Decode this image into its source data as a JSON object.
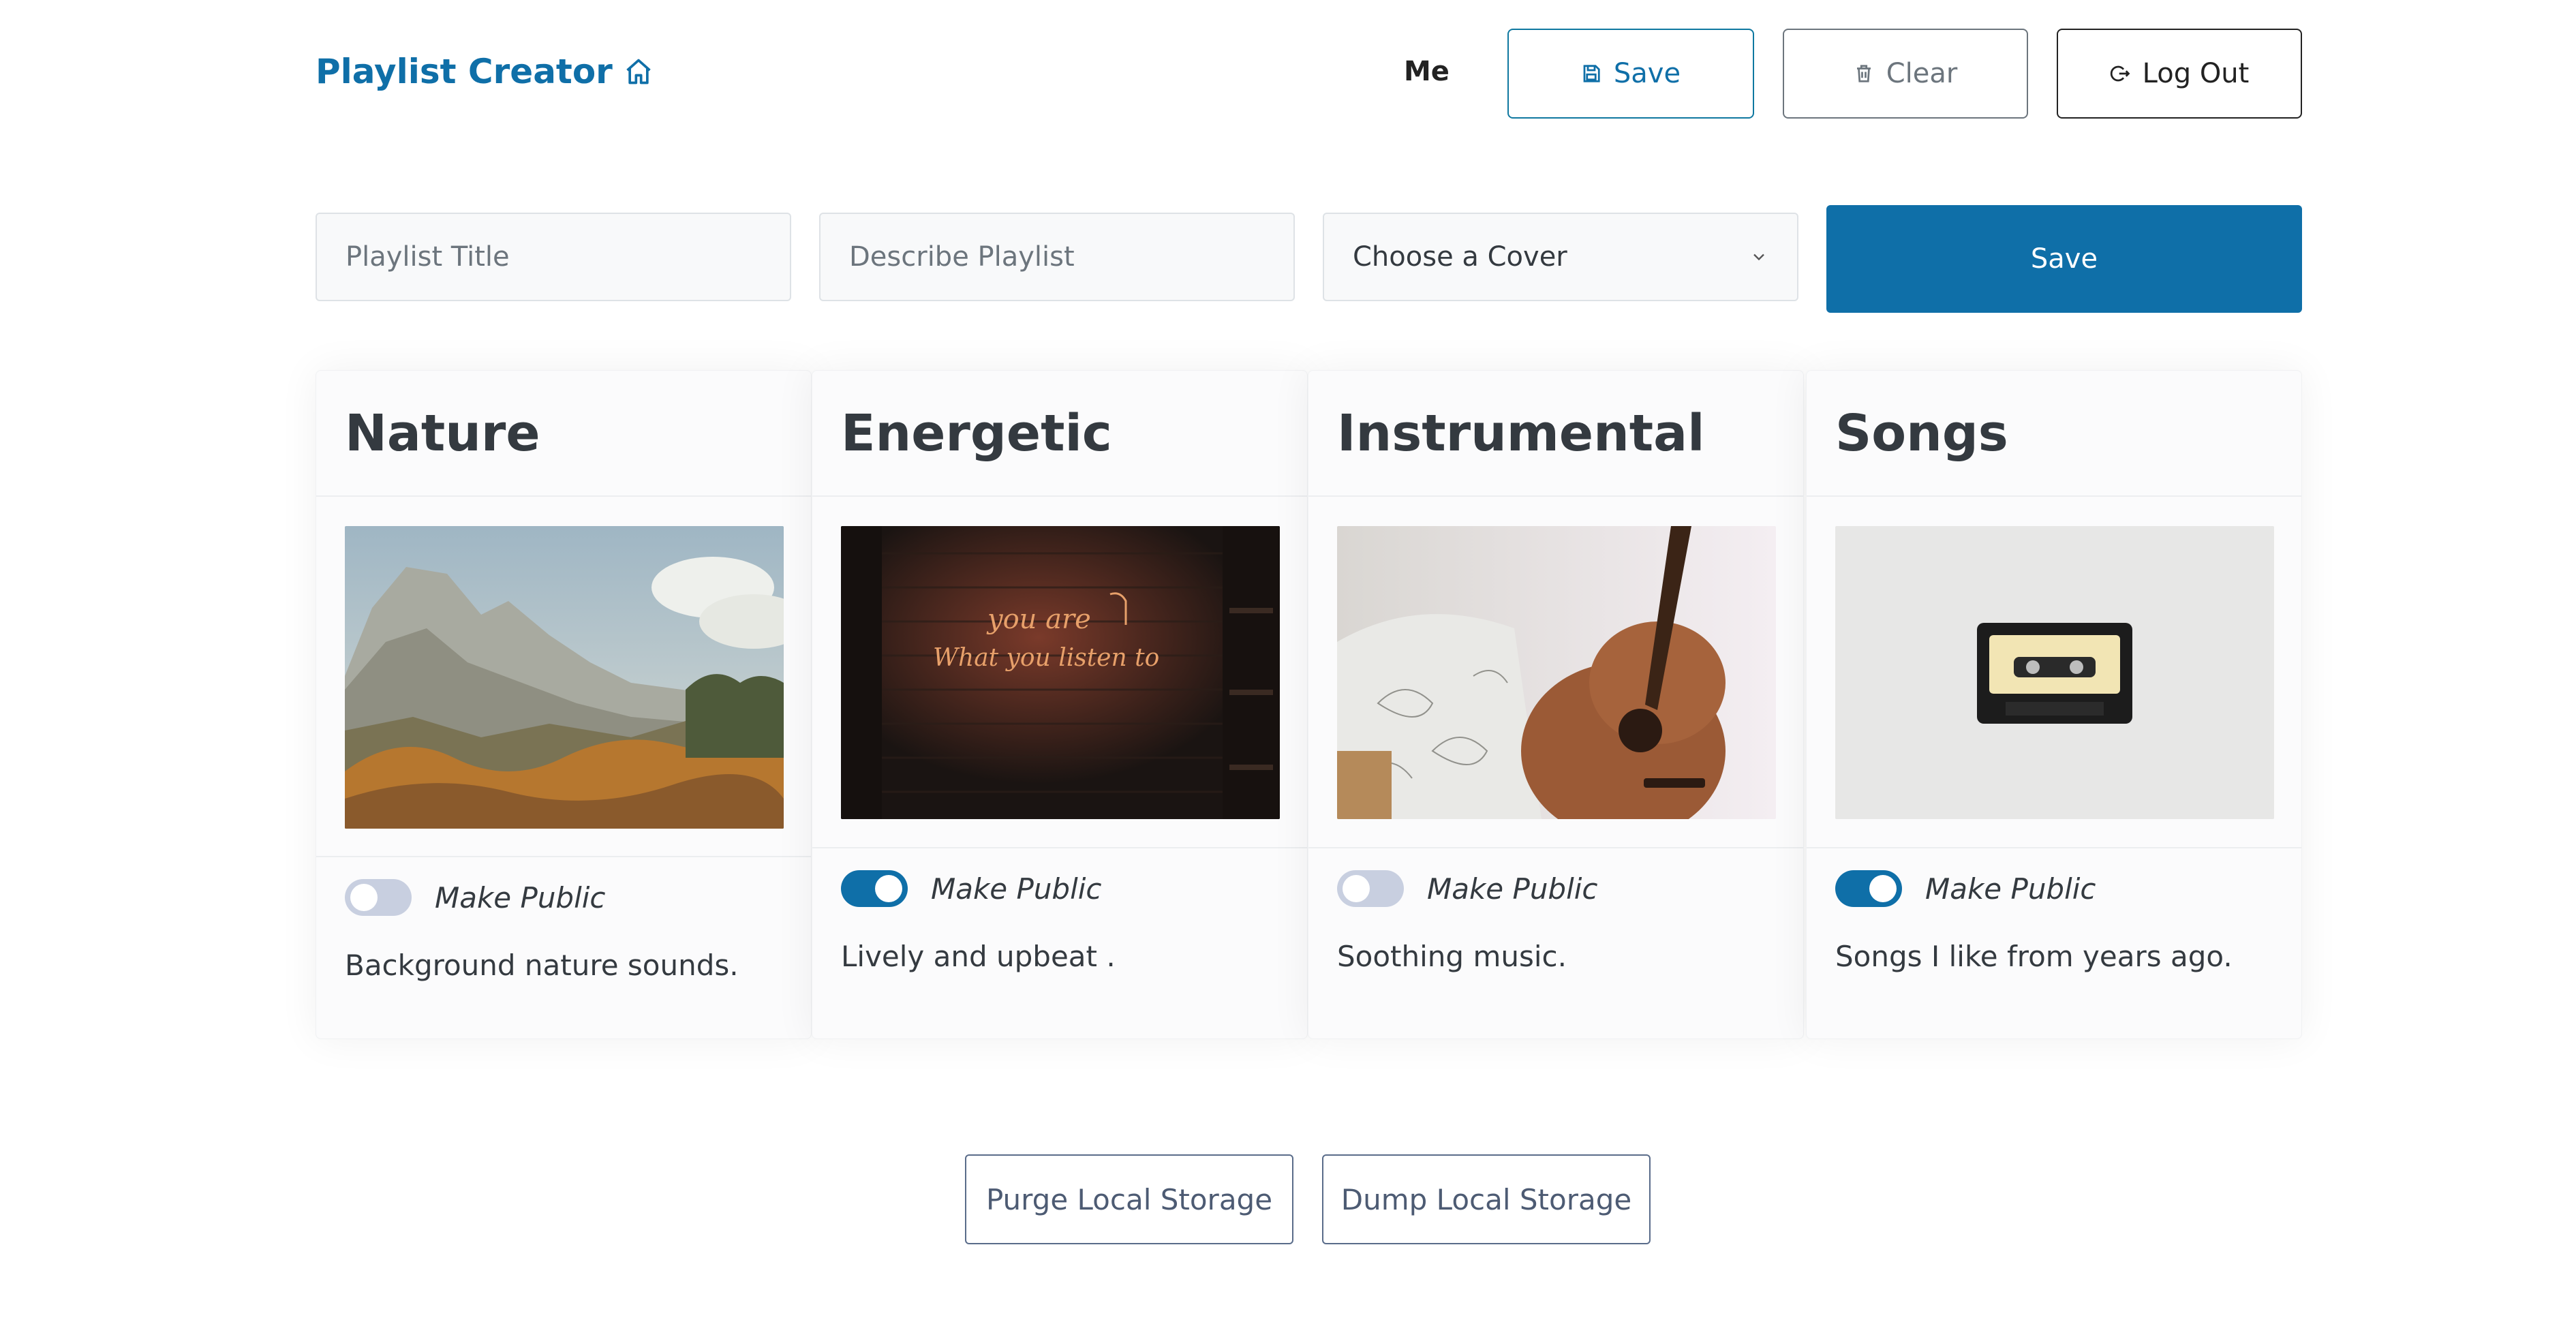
{
  "header": {
    "brand": "Playlist Creator",
    "user": "Me",
    "save_label": "Save",
    "clear_label": "Clear",
    "logout_label": "Log Out"
  },
  "form": {
    "title_placeholder": "Playlist Title",
    "desc_placeholder": "Describe Playlist",
    "cover_selected": "Choose a Cover",
    "save_label": "Save"
  },
  "cards": [
    {
      "title": "Nature",
      "toggle_label": "Make Public",
      "public": false,
      "description": "Background nature sounds."
    },
    {
      "title": "Energetic",
      "toggle_label": "Make Public",
      "public": true,
      "description": "Lively and upbeat ."
    },
    {
      "title": "Instrumental",
      "toggle_label": "Make Public",
      "public": false,
      "description": "Soothing music."
    },
    {
      "title": "Songs",
      "toggle_label": "Make Public",
      "public": true,
      "description": "Songs I like from years ago."
    }
  ],
  "neon_text": [
    "you are",
    "What you listen to"
  ],
  "footer": {
    "purge_label": "Purge Local Storage",
    "dump_label": "Dump Local Storage"
  },
  "colors": {
    "brand": "#0f6fa8",
    "toggle_off": "#c8cfe0",
    "toggle_on": "#0f6fa8"
  }
}
